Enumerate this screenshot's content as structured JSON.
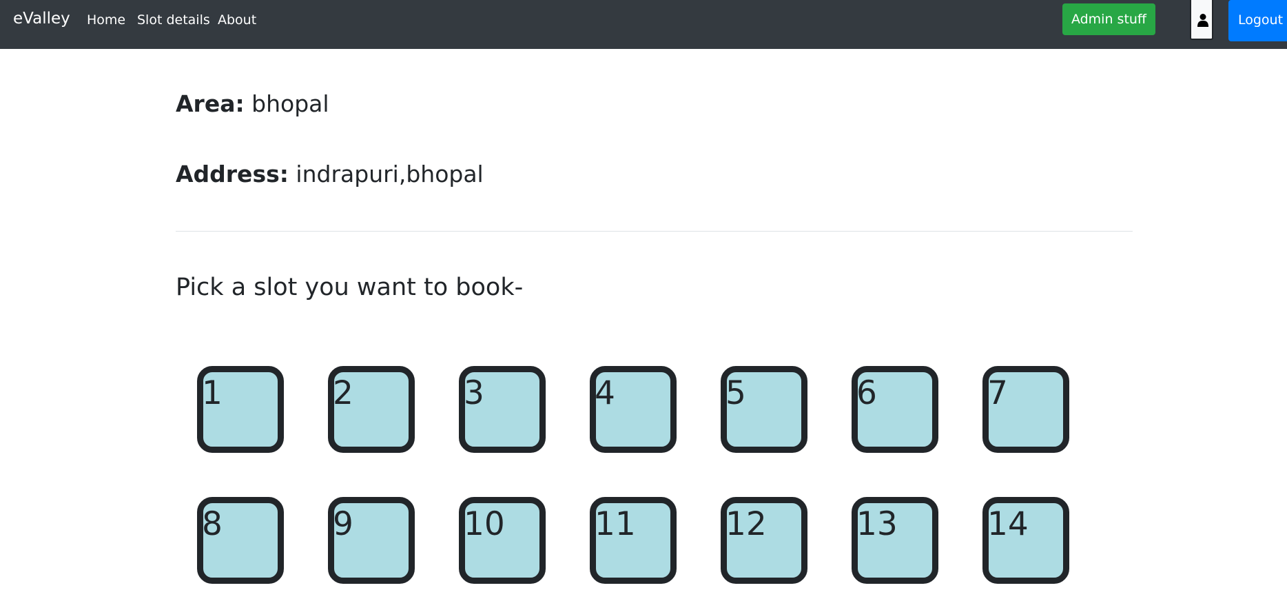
{
  "navbar": {
    "brand": "eValley",
    "links": [
      "Home",
      "Slot details",
      "About"
    ],
    "admin_button": "Admin stuff",
    "user_icon": "person-icon",
    "logout_button": "Logout"
  },
  "details": {
    "area_label": "Area:",
    "area_value": "bhopal",
    "address_label": "Address:",
    "address_value": "indrapuri,bhopal"
  },
  "prompt": "Pick a slot you want to book-",
  "slots": [
    "1",
    "2",
    "3",
    "4",
    "5",
    "6",
    "7",
    "8",
    "9",
    "10",
    "11",
    "12",
    "13",
    "14"
  ],
  "colors": {
    "navbar_bg": "#343a40",
    "admin_button": "#28a745",
    "logout_button": "#007bff",
    "slot_fill": "#addce3",
    "slot_border": "#212529"
  }
}
